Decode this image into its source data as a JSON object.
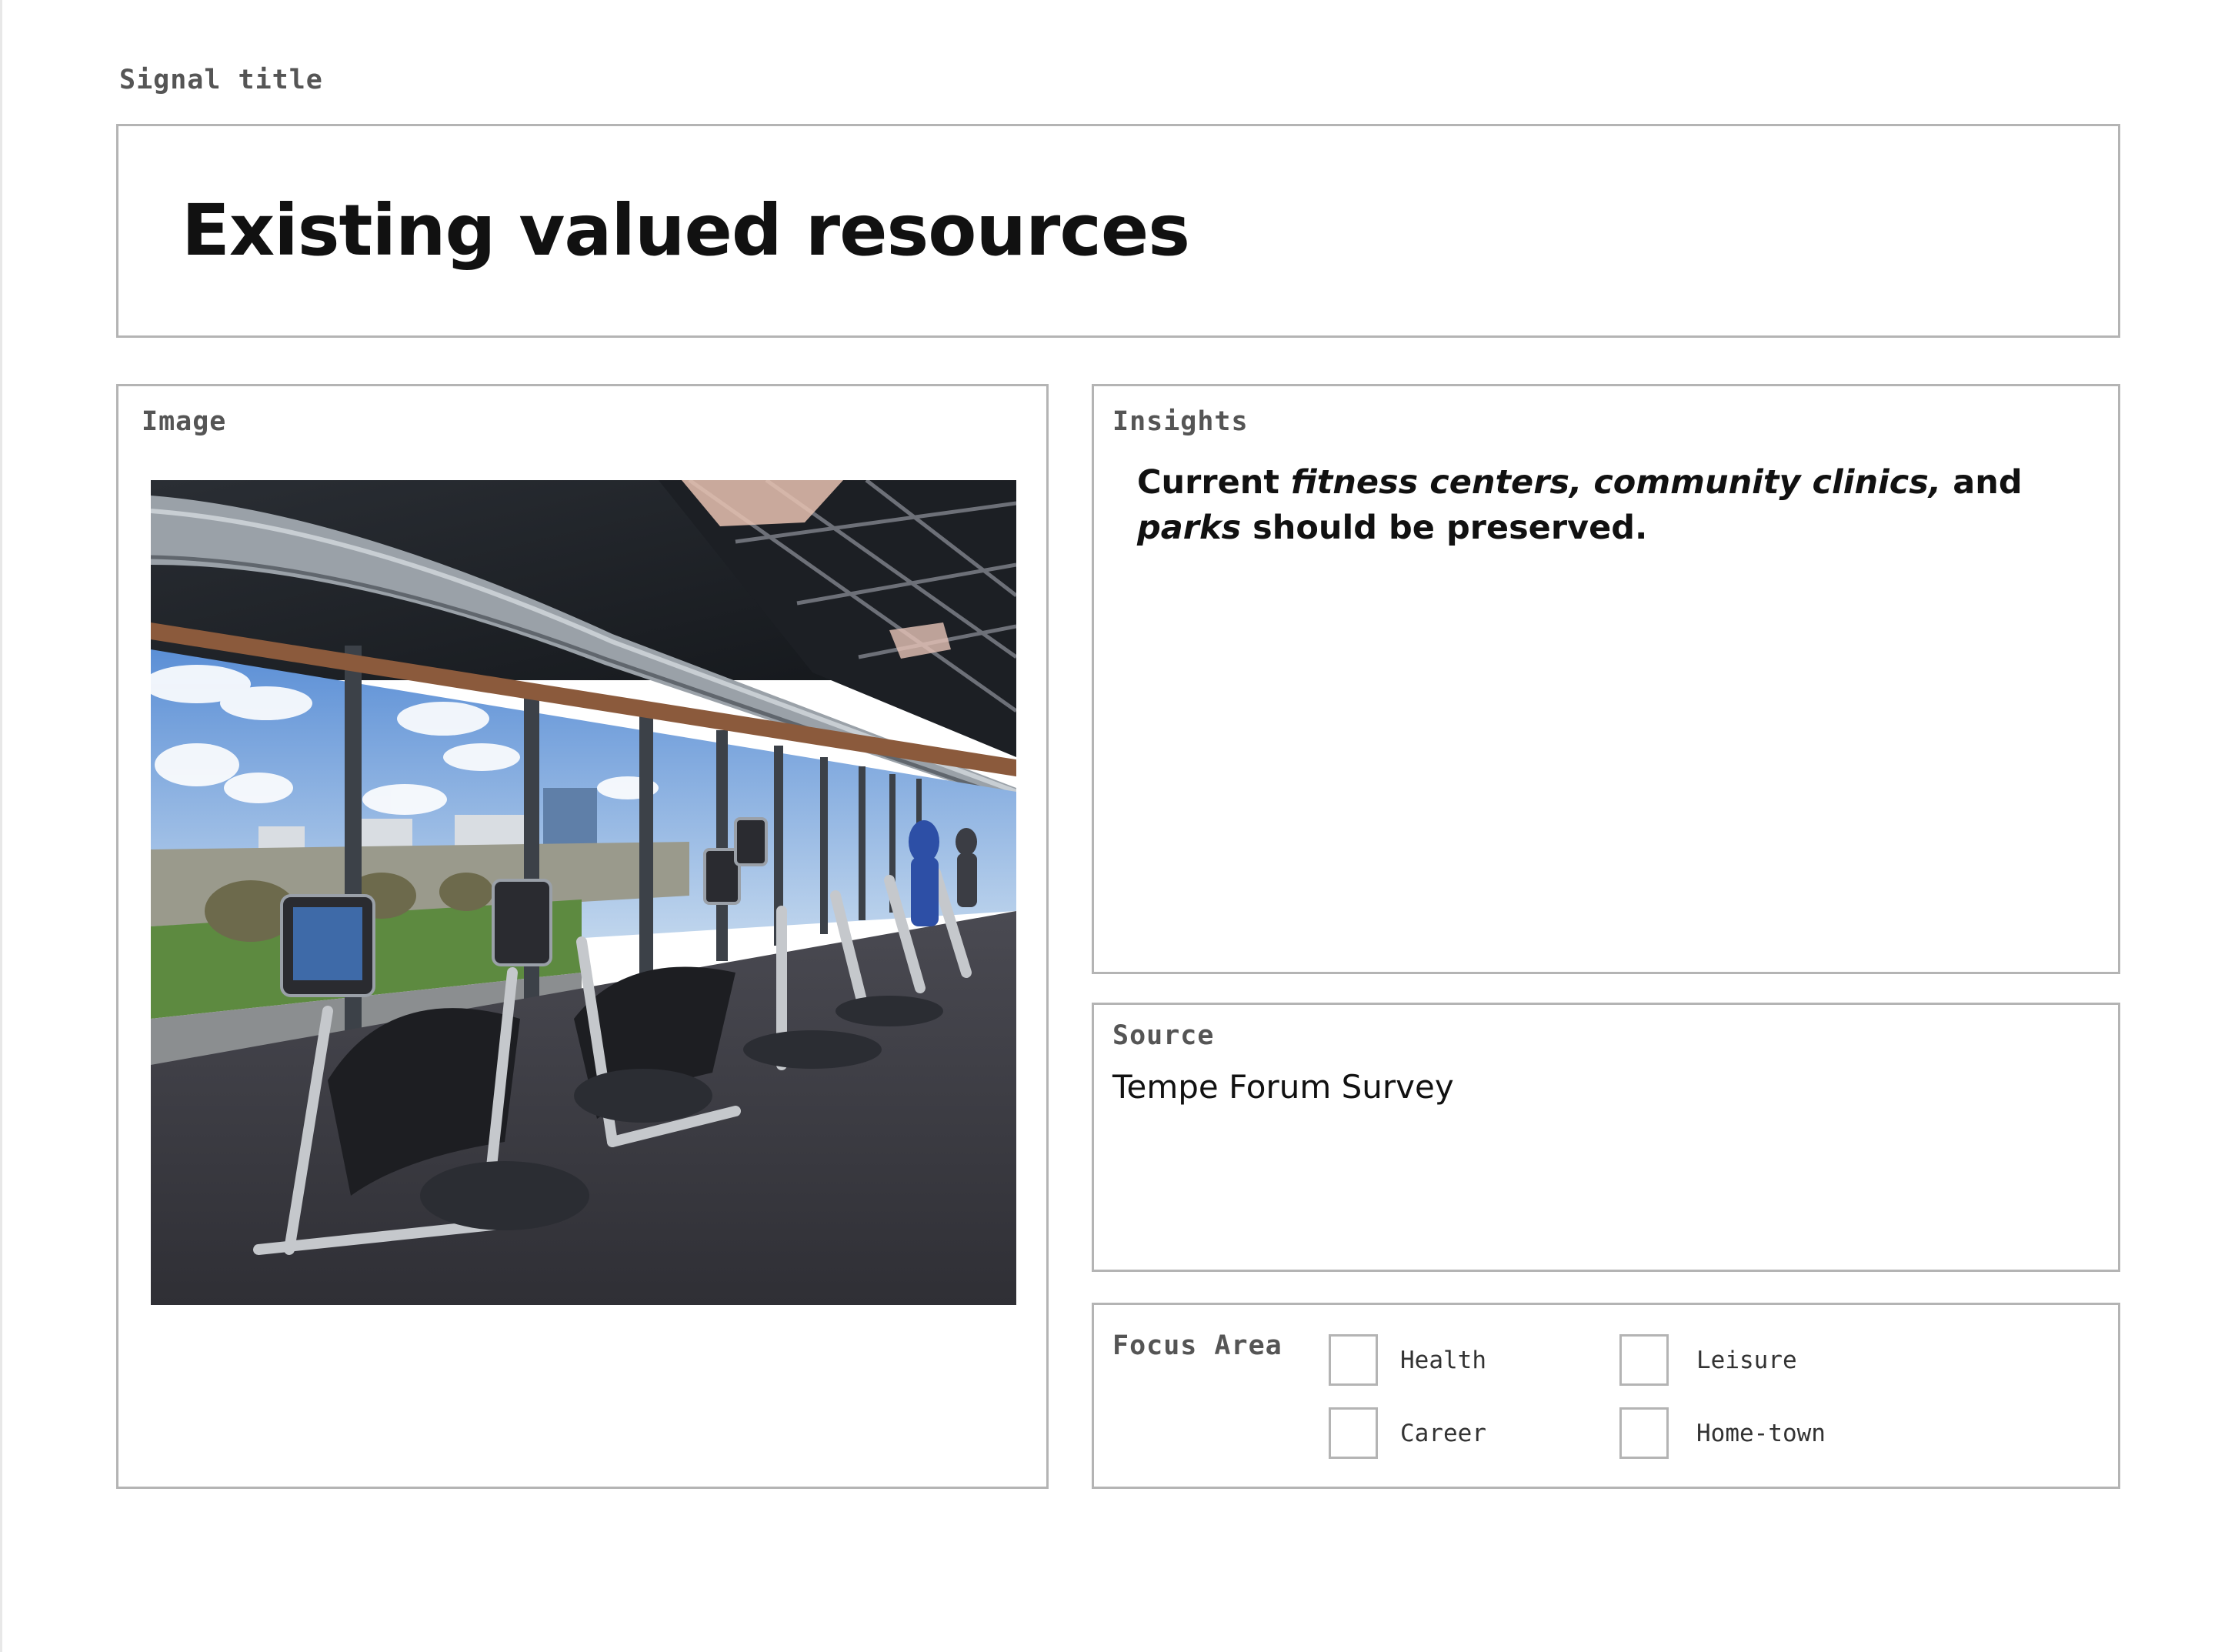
{
  "signal": {
    "caption": "Signal title",
    "title": "Existing valued resources"
  },
  "image_panel": {
    "caption": "Image",
    "photo_alt": "Gym with rows of exercise bikes and ellipticals facing large windows overlooking a lake, park and city buildings"
  },
  "insights": {
    "caption": "Insights",
    "segments": {
      "s1": "Current ",
      "s2": "fitness centers, community clinics,",
      "s3": " and ",
      "s4": "parks",
      "s5": " should be preserved."
    }
  },
  "source": {
    "caption": "Source",
    "value": "Tempe Forum Survey"
  },
  "focus_area": {
    "caption": "Focus Area",
    "options": [
      {
        "label": "Health",
        "checked": false
      },
      {
        "label": "Leisure",
        "checked": false
      },
      {
        "label": "Career",
        "checked": false
      },
      {
        "label": "Home-town",
        "checked": false
      }
    ]
  }
}
